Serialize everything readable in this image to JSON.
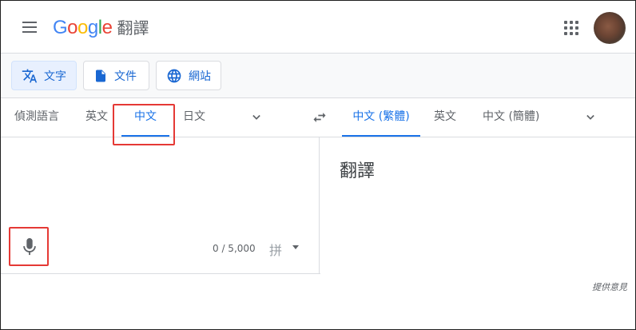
{
  "header": {
    "logo_letters": [
      {
        "ch": "G",
        "color": "#4285F4"
      },
      {
        "ch": "o",
        "color": "#EA4335"
      },
      {
        "ch": "o",
        "color": "#FBBC05"
      },
      {
        "ch": "g",
        "color": "#4285F4"
      },
      {
        "ch": "l",
        "color": "#34A853"
      },
      {
        "ch": "e",
        "color": "#EA4335"
      }
    ],
    "product": "翻譯",
    "icons": [
      "menu-icon",
      "apps-grid-icon",
      "avatar"
    ]
  },
  "modes": [
    {
      "label": "文字",
      "icon": "translate-icon",
      "active": true
    },
    {
      "label": "文件",
      "icon": "document-icon",
      "active": false
    },
    {
      "label": "網站",
      "icon": "globe-icon",
      "active": false
    }
  ],
  "source_langs": [
    {
      "label": "偵測語言",
      "selected": false
    },
    {
      "label": "英文",
      "selected": false
    },
    {
      "label": "中文",
      "selected": true
    },
    {
      "label": "日文",
      "selected": false
    }
  ],
  "target_langs": [
    {
      "label": "中文 (繁體)",
      "selected": true
    },
    {
      "label": "英文",
      "selected": false
    },
    {
      "label": "中文 (簡體)",
      "selected": false
    }
  ],
  "source": {
    "text": "",
    "char_count": "0 / 5,000",
    "ime_label": "拼"
  },
  "target": {
    "placeholder": "翻譯"
  },
  "footer": {
    "feedback": "提供意見"
  },
  "colors": {
    "accent": "#1a73e8",
    "highlight": "#e53935"
  }
}
